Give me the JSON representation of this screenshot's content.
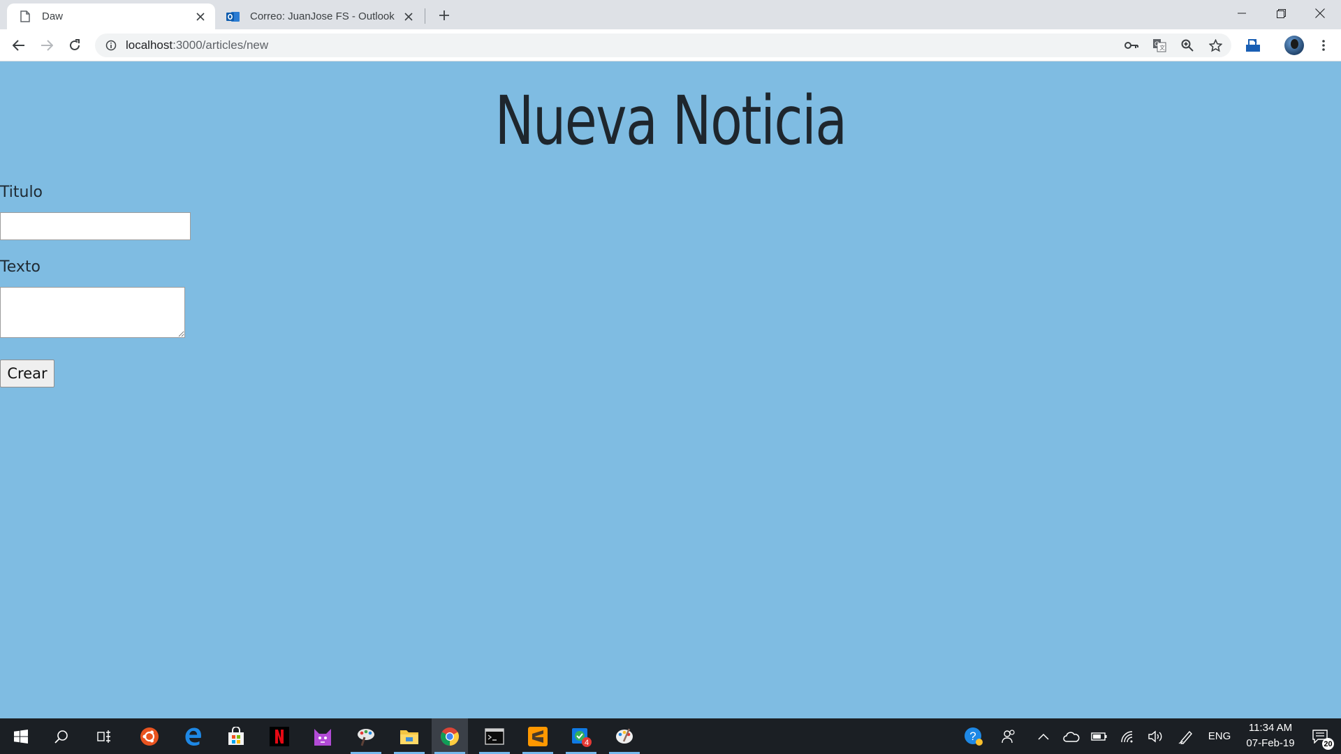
{
  "browser": {
    "tabs": [
      {
        "title": "Daw",
        "active": true
      },
      {
        "title": "Correo: JuanJose FS - Outlook",
        "active": false
      }
    ],
    "url_host": "localhost",
    "url_path": ":3000/articles/new"
  },
  "page": {
    "heading": "Nueva Noticia",
    "titulo_label": "Titulo",
    "titulo_value": "",
    "texto_label": "Texto",
    "texto_value": "",
    "submit_label": "Crear",
    "background_color": "#7fbce2"
  },
  "taskbar": {
    "language": "ENG",
    "time": "11:34 AM",
    "date": "07-Feb-19",
    "notification_count": "20",
    "mail_badge": "4"
  }
}
